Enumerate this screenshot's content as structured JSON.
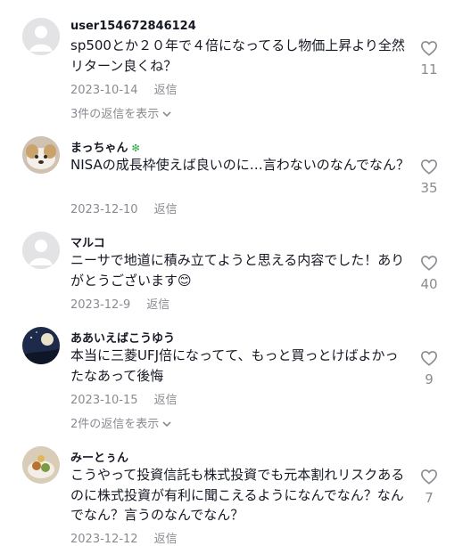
{
  "comments": [
    {
      "username": "user154672846124",
      "badge": "",
      "text": "sp500とか２０年で４倍になってるし物価上昇より全然リターン良くね？",
      "date": "2023-10-14",
      "reply_label": "返信",
      "likes": "11",
      "view_replies": "3件の返信を表示"
    },
    {
      "username": "まっちゃん",
      "badge": "❇",
      "text": "NISAの成長枠使えば良いのに…言わないのなんでなん？",
      "date": "2023-12-10",
      "reply_label": "返信",
      "likes": "35",
      "view_replies": ""
    },
    {
      "username": "マルコ",
      "badge": "",
      "text": "ニーサで地道に積み立てようと思える内容でした！ありがとうございます😊",
      "date": "2023-12-9",
      "reply_label": "返信",
      "likes": "40",
      "view_replies": ""
    },
    {
      "username": "ああいえばこうゆう",
      "badge": "",
      "text": "本当に三菱UFJ倍になってて、もっと買っとけばよかったなあって後悔",
      "date": "2023-10-15",
      "reply_label": "返信",
      "likes": "9",
      "view_replies": "2件の返信を表示"
    },
    {
      "username": "みーとぅん",
      "badge": "",
      "text": "こうやって投資信託も株式投資でも元本割れリスクあるのに株式投資が有利に聞こえるようになんでなん？なんでなん？言うのなんでなん？",
      "date": "2023-12-12",
      "reply_label": "返信",
      "likes": "7",
      "view_replies": ""
    }
  ]
}
